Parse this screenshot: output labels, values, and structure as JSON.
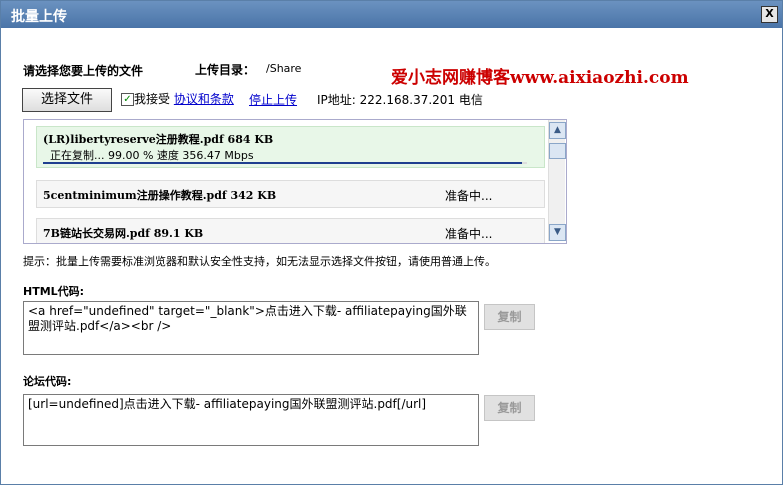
{
  "window": {
    "title": "批量上传",
    "close_label": "X"
  },
  "form": {
    "select_prompt": "请选择您要上传的文件",
    "upload_dir_label": "上传目录：",
    "upload_dir_value": "/Share",
    "choose_button": "选择文件",
    "agree_label": "我接受",
    "agree_checked": true,
    "terms_link": "协议和条款",
    "stop_link": "停止上传",
    "ip_label": "IP地址: 222.168.37.201 电信"
  },
  "brand_text": "爱小志网赚博客www.aixiaozhi.com",
  "uploads": [
    {
      "name": "(LR)libertyreserve注册教程.pdf 684 KB",
      "status": "正在复制... 99.00 % 速度 356.47 Mbps",
      "progress": 0.99
    },
    {
      "name": "5centminimum注册操作教程.pdf 342 KB",
      "status": "准备中..."
    },
    {
      "name": "7B链站长交易网.pdf 89.1 KB",
      "status": "准备中..."
    }
  ],
  "tip": "提示：批量上传需要标准浏览器和默认安全性支持，如无法显示选择文件按钮，请使用普通上传。",
  "html_code": {
    "label": "HTML代码:",
    "value": "<a href=\"undefined\" target=\"_blank\">点击进入下载- affiliatepaying国外联盟测评站.pdf</a><br />",
    "copy_label": "复制"
  },
  "forum_code": {
    "label": "论坛代码:",
    "value": "[url=undefined]点击进入下载- affiliatepaying国外联盟测评站.pdf[/url]",
    "copy_label": "复制"
  },
  "colors": {
    "titlebar": "#4a74a8",
    "progress": "#1f3f8f",
    "brand": "#cc0000",
    "link": "#0000cc"
  }
}
